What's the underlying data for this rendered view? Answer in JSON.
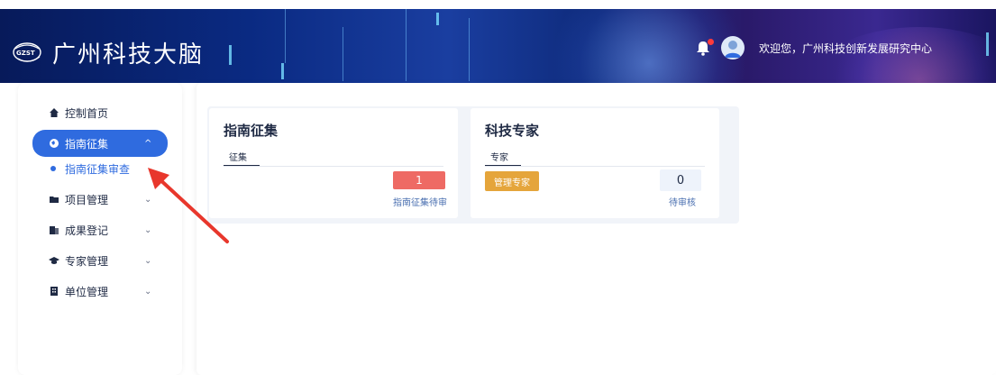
{
  "header": {
    "title": "广州科技大脑",
    "logo_text": "GZST",
    "welcome": "欢迎您，广州科技创新发展研究中心",
    "bell_icon": "bell-icon",
    "avatar_icon": "user-avatar-icon"
  },
  "sidebar": {
    "items": [
      {
        "label": "控制首页",
        "icon": "home-icon"
      },
      {
        "label": "指南征集",
        "icon": "globe-icon",
        "chevron": "^"
      },
      {
        "label": "项目管理",
        "icon": "folder-icon",
        "chevron": "⌄"
      },
      {
        "label": "成果登记",
        "icon": "document-icon",
        "chevron": "⌄"
      },
      {
        "label": "专家管理",
        "icon": "mortarboard-icon",
        "chevron": "⌄"
      },
      {
        "label": "单位管理",
        "icon": "building-icon",
        "chevron": "⌄"
      }
    ],
    "sub_items": [
      {
        "label": "指南征集审查"
      }
    ]
  },
  "cards": [
    {
      "title": "指南征集",
      "tab": "征集",
      "stat_value": "1",
      "stat_label": "指南征集待审"
    },
    {
      "title": "科技专家",
      "tab": "专家",
      "button": "管理专家",
      "stat_value": "0",
      "stat_label": "待审核"
    }
  ],
  "colors": {
    "accent": "#2f6bdf",
    "danger": "#ee6a64",
    "warning": "#e5a53b",
    "text": "#1f2a44",
    "annotation_arrow": "#e8372c"
  }
}
